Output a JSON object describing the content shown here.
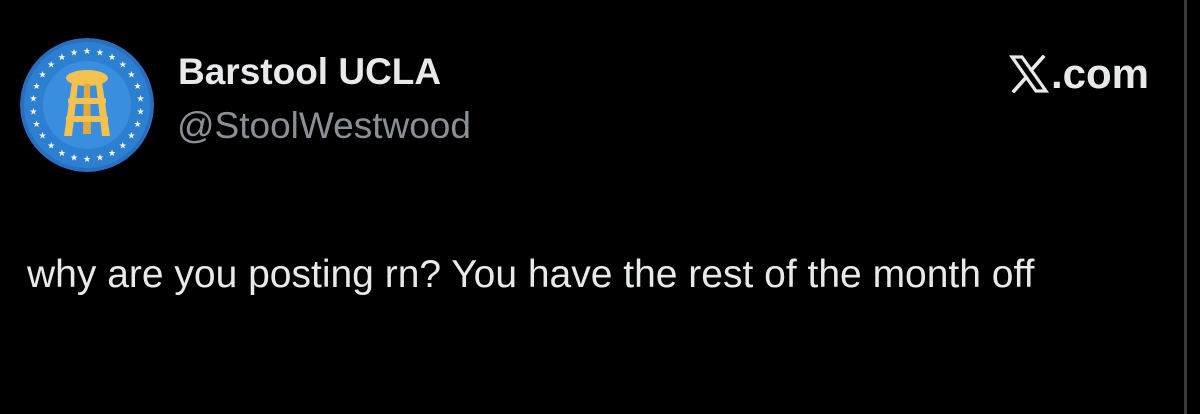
{
  "account": {
    "display_name": "Barstool UCLA",
    "handle": "@StoolWestwood"
  },
  "brand": {
    "label": ".com",
    "icon": "x-logo-icon"
  },
  "post": {
    "text": "why are you posting rn? You have the rest of the month off"
  },
  "avatar": {
    "icon": "barstool-logo-icon",
    "colors": {
      "outer_ring": "#2d7fd1",
      "star_band": "#2a6fbf",
      "inner_circle": "#3a8ee0",
      "stool": "#f2c14e",
      "stars": "#ffffff"
    }
  },
  "colors": {
    "background": "#000000",
    "text_primary": "#e7e9ea",
    "text_secondary": "#8b9096"
  }
}
